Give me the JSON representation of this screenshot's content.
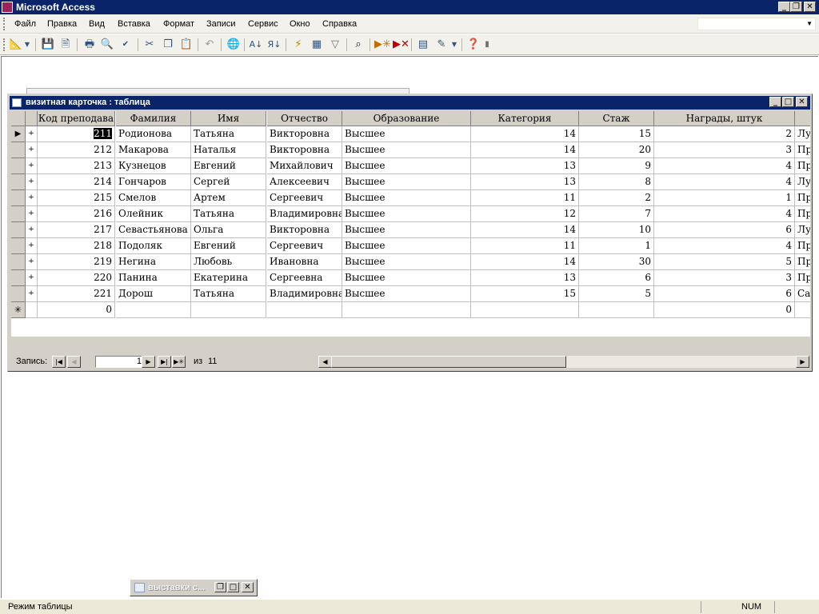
{
  "app": {
    "title": "Microsoft Access"
  },
  "menu": [
    "Файл",
    "Правка",
    "Вид",
    "Вставка",
    "Формат",
    "Записи",
    "Сервис",
    "Окно",
    "Справка"
  ],
  "toolbar_icons": [
    "design-view-icon",
    "dropdown-arrow-icon",
    "save-icon",
    "search-file-icon",
    "print-icon",
    "print-preview-icon",
    "spellcheck-icon",
    "cut-icon",
    "copy-icon",
    "paste-icon",
    "undo-icon",
    "hyperlink-icon",
    "sort-ascending-icon",
    "sort-descending-icon",
    "filter-by-selection-icon",
    "filter-by-form-icon",
    "apply-filter-icon",
    "find-icon",
    "new-record-icon",
    "delete-record-icon",
    "database-window-icon",
    "new-object-icon",
    "help-icon"
  ],
  "child_window": {
    "title": "визитная карточка : таблица"
  },
  "table": {
    "columns": [
      "Код преподава",
      "Фамилия",
      "Имя",
      "Отчество",
      "Образование",
      "Категория",
      "Стаж",
      "Награды, штук"
    ],
    "rows": [
      [
        "211",
        "Родионова",
        "Татьяна",
        "Викторовна",
        "Высшее",
        "14",
        "15",
        "2",
        "Лу"
      ],
      [
        "212",
        "Макарова",
        "Наталья",
        "Викторовна",
        "Высшее",
        "14",
        "20",
        "3",
        "Пр"
      ],
      [
        "213",
        "Кузнецов",
        "Евгений",
        "Михайлович",
        "Высшее",
        "13",
        "9",
        "4",
        "Пр"
      ],
      [
        "214",
        "Гончаров",
        "Сергей",
        "Алексеевич",
        "Высшее",
        "13",
        "8",
        "4",
        "Лу"
      ],
      [
        "215",
        "Смелов",
        "Артем",
        "Сергеевич",
        "Высшее",
        "11",
        "2",
        "1",
        "Пр"
      ],
      [
        "216",
        "Олейник",
        "Татьяна",
        "Владимировна",
        "Высшее",
        "12",
        "7",
        "4",
        "Пр"
      ],
      [
        "217",
        "Севастьянова",
        "Ольга",
        "Викторовна",
        "Высшее",
        "14",
        "10",
        "6",
        "Лу"
      ],
      [
        "218",
        "Подоляк",
        "Евгений",
        "Сергеевич",
        "Высшее",
        "11",
        "1",
        "4",
        "Пр"
      ],
      [
        "219",
        "Негина",
        "Любовь",
        "Ивановна",
        "Высшее",
        "14",
        "30",
        "5",
        "Пр"
      ],
      [
        "220",
        "Панина",
        "Екатерина",
        "Сергеевна",
        "Высшее",
        "13",
        "6",
        "3",
        "Пр"
      ],
      [
        "221",
        "Дорош",
        "Татьяна",
        "Владимировна",
        "Высшее",
        "15",
        "5",
        "6",
        "Са"
      ]
    ],
    "new_row": {
      "code": "0",
      "awards": "0"
    },
    "new_row_marker": "✳",
    "current_row_marker": "▶",
    "expand_glyph": "+"
  },
  "navigator": {
    "label": "Запись:",
    "current": "1",
    "of_label": "из",
    "total": "11"
  },
  "minimized_window": {
    "title": "выставки с..."
  },
  "status": {
    "mode": "Режим таблицы",
    "num": "NUM"
  }
}
